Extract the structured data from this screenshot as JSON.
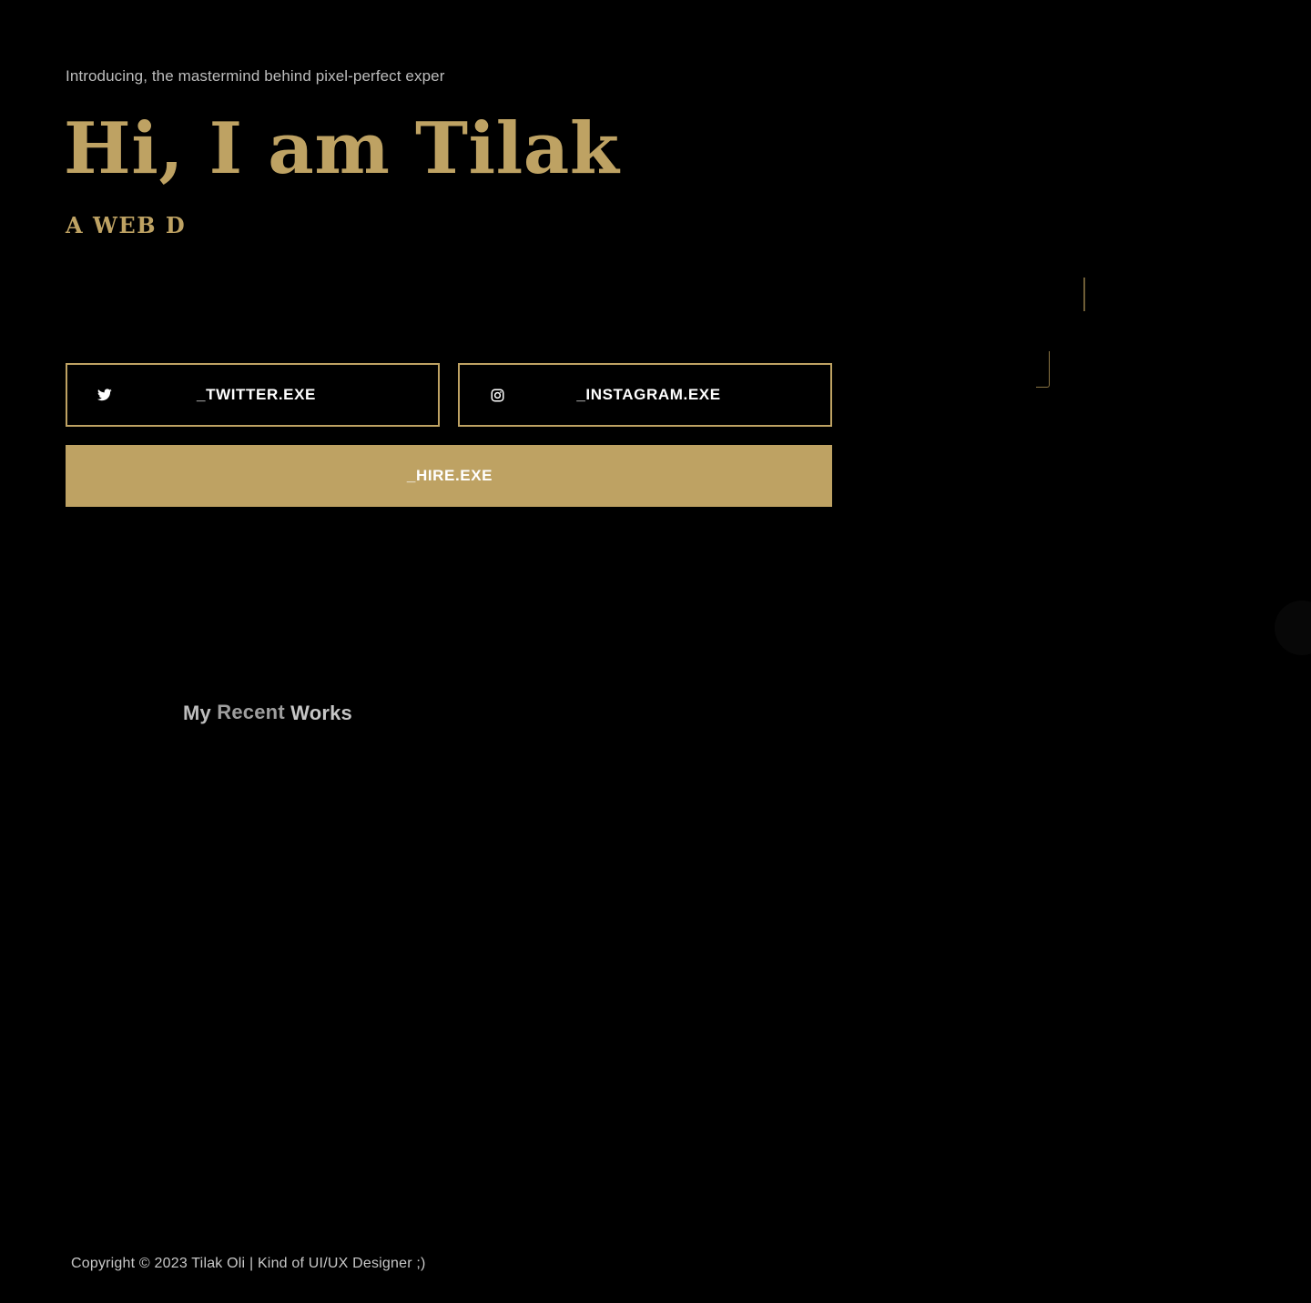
{
  "hero": {
    "intro": "Introducing, the mastermind behind pixel-perfect exper",
    "title": "Hi, I am Tilak",
    "subtitle": "A WEB D"
  },
  "social": {
    "twitter": {
      "label": "_TWITTER.EXE",
      "icon": "twitter-icon"
    },
    "instagram": {
      "label": "_INSTAGRAM.EXE",
      "icon": "instagram-icon"
    }
  },
  "hire": {
    "label": "_HIRE.EXE"
  },
  "works": {
    "title_part1": "My",
    "title_part2": "Recent",
    "title_part3": "Works"
  },
  "footer": {
    "copyright": "Copyright © 2023 Tilak Oli | Kind of UI/UX Designer ;)"
  },
  "colors": {
    "background": "#000000",
    "accent_gold": "#bea263",
    "text_muted": "#bdbdbd",
    "text_white": "#ffffff"
  }
}
